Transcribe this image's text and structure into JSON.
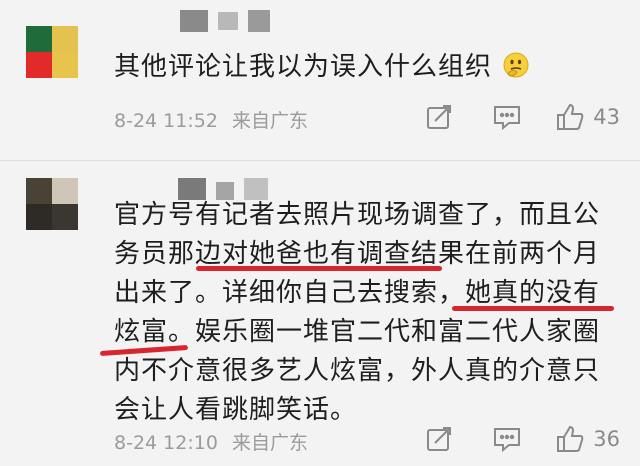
{
  "comments": [
    {
      "avatar_colors": [
        "#1f6b3a",
        "#e3c24f",
        "#e12a2a",
        "#e9c44d"
      ],
      "name_block_colors": [
        "#8a8a8a",
        "#b8b8b8",
        "#9a9a9a"
      ],
      "text": "其他评论让我以为误入什么组织",
      "emoji": "thinking-face-icon",
      "date": "8-24 11:52",
      "location": "来自广东",
      "likes": "43"
    },
    {
      "avatar_colors": [
        "#4b4236",
        "#cfc6b7",
        "#2e2a25",
        "#3c3630"
      ],
      "name_block_colors": [
        "#7a7a7a",
        "#a5a5a5",
        "#c0c0c0"
      ],
      "lines": [
        "官方号有记者去照片现场调查了，而且公",
        "务员那边对她爸也有调查结果在前两个月",
        "出来了。详细你自己去搜索，她真的没有",
        "炫富。娱乐圈一堆官二代和富二代人家圈",
        "内不介意很多艺人炫富，外人真的介意只",
        "会让人看跳脚笑话。"
      ],
      "date": "8-24 12:10",
      "location": "来自广东",
      "likes": "36"
    }
  ],
  "accent_underline_color": "#d7262d",
  "icon_color": "#8a8a8a"
}
